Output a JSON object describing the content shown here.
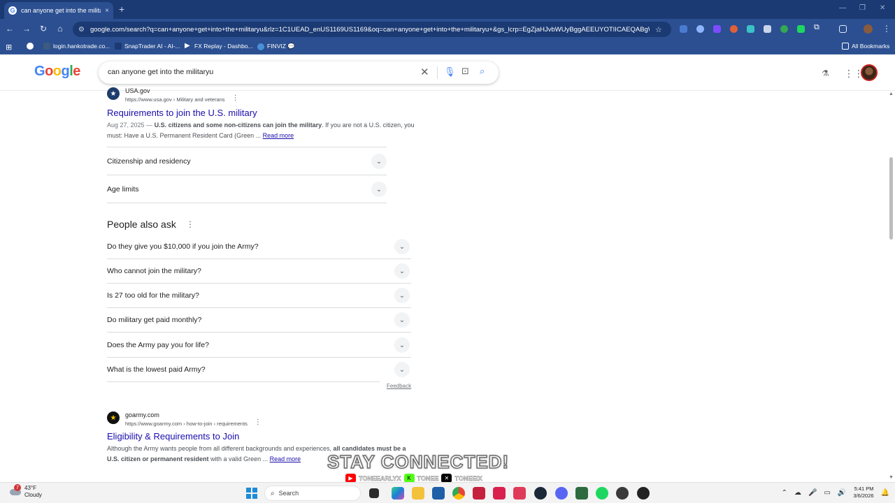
{
  "browser": {
    "tab_title": "can anyone get into the militar",
    "tab_close": "×",
    "new_tab": "+",
    "url": "google.com/search?q=can+anyone+get+into+the+militaryu&rlz=1C1UEAD_enUS1169US1169&oq=can+anyone+get+into+the+militaryu+&gs_lcrp=EgZjaHJvbWUyBggAEEUYOTIICAEQABgW...",
    "bookmarks": [
      {
        "label": "login.hankotrade.co...",
        "color": "#3d5a80"
      },
      {
        "label": "SnapTrader AI - AI-...",
        "color": "#2b4f91"
      },
      {
        "label": "FX Replay - Dashbo...",
        "color": "#ffffff"
      },
      {
        "label": "FINVIZ 💬",
        "color": "#4a90d9"
      }
    ],
    "all_bookmarks": "All Bookmarks"
  },
  "google": {
    "logo": "Google",
    "query": "can anyone get into the militaryu"
  },
  "results": [
    {
      "site_name": "USA.gov",
      "site_url": "https://www.usa.gov › Military and veterans",
      "title": "Requirements to join the U.S. military",
      "snippet_date": "Aug 27, 2025 — ",
      "snippet_bold": "U.S. citizens and some non-citizens can join the military",
      "snippet_rest": ". If you are not a U.S. citizen, you must: Have a U.S. Permanent Resident Card (Green ... ",
      "read_more": "Read more"
    },
    {
      "site_name": "goarmy.com",
      "site_url": "https://www.goarmy.com › how-to-join › requirements",
      "title": "Eligibility & Requirements to Join",
      "snippet_pre": "Although the Army wants people from all different backgrounds and experiences, ",
      "snippet_bold": "all candidates must be a U.S. citizen or permanent resident",
      "snippet_rest": " with a valid Green ... ",
      "read_more": "Read more"
    }
  ],
  "expanders": [
    "Citizenship and residency",
    "Age limits"
  ],
  "people_also_ask": {
    "title": "People also ask",
    "questions": [
      "Do they give you $10,000 if you join the Army?",
      "Who cannot join the military?",
      "Is 27 too old for the military?",
      "Do military get paid monthly?",
      "Does the Army pay you for life?",
      "What is the lowest paid Army?"
    ],
    "feedback": "Feedback"
  },
  "overlay": {
    "headline": "STAY CONNECTED!",
    "handle1": "TONEEARLYX",
    "handle2": "TONEE",
    "handle3": "TONEEIX"
  },
  "taskbar": {
    "weather_temp": "43°F",
    "weather_desc": "Cloudy",
    "weather_badge": "7",
    "search_label": "Search",
    "time": "5:41 PM",
    "date": "3/6/2026"
  }
}
